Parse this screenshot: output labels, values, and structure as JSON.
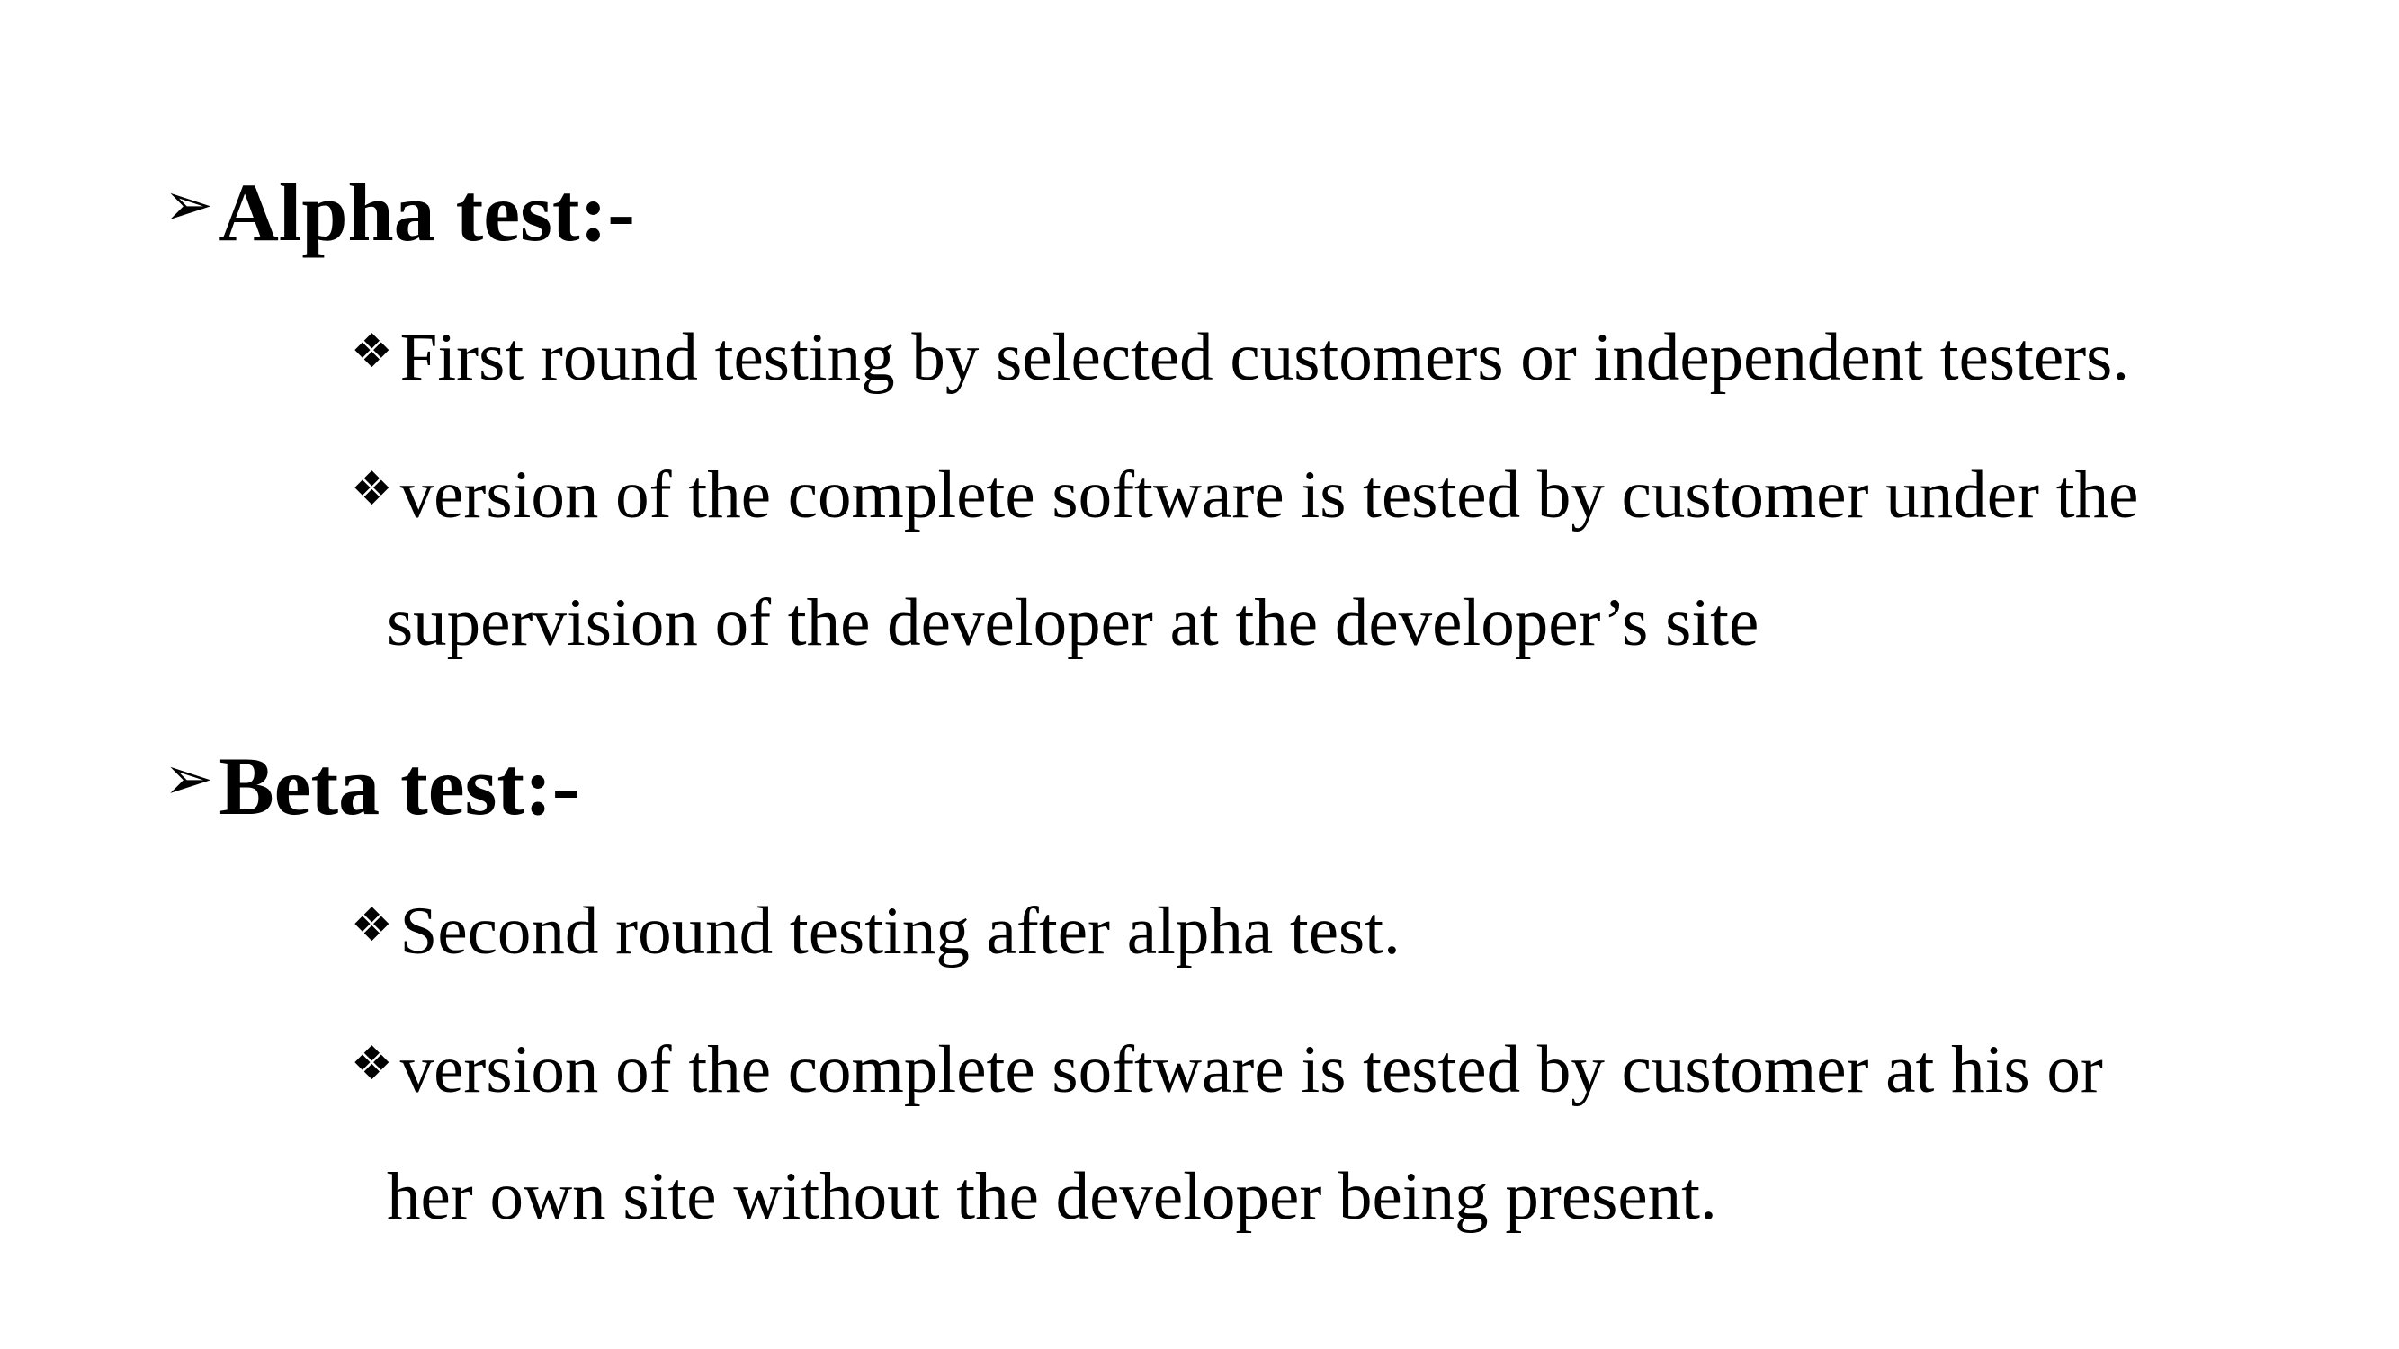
{
  "sections": [
    {
      "heading": "Alpha test:-",
      "bullets": [
        {
          "lines": [
            "First round testing by selected customers or independent testers."
          ]
        },
        {
          "lines": [
            "version of the complete software is tested by customer under the",
            "supervision of the developer at the developer’s site"
          ]
        }
      ]
    },
    {
      "heading": "Beta test:-",
      "bullets": [
        {
          "lines": [
            "Second round testing after alpha test."
          ]
        },
        {
          "lines": [
            "version of the complete software is tested by customer at his or",
            "her own site without the developer being present."
          ]
        }
      ]
    }
  ],
  "icons": {
    "heading_marker": "arrowhead-bullet-icon",
    "item_marker": "four-diamond-bullet-icon"
  }
}
